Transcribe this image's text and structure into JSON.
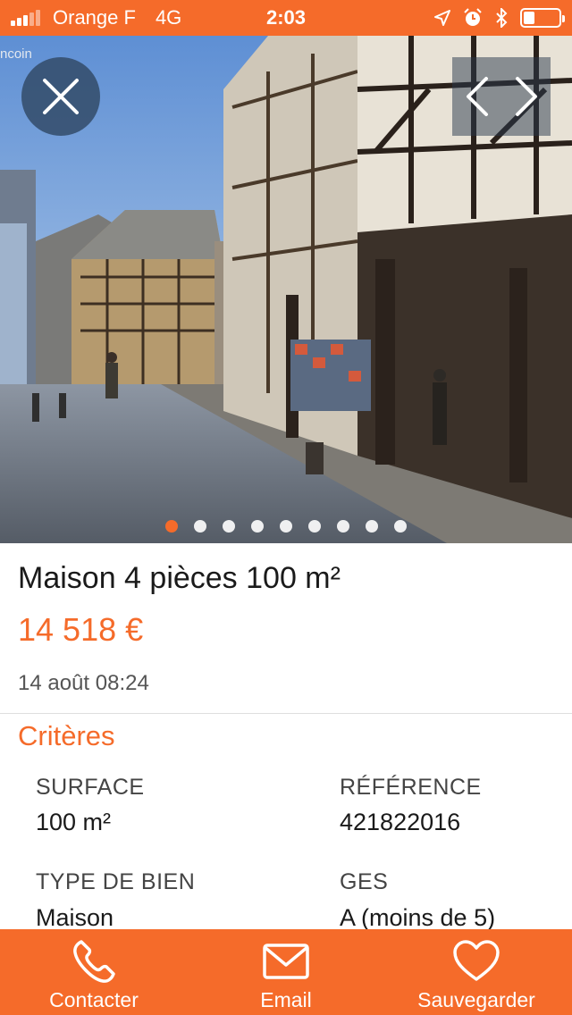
{
  "status_bar": {
    "carrier": "Orange F",
    "network": "4G",
    "time": "2:03"
  },
  "hero": {
    "watermark": "ncoin",
    "photo_count": 9,
    "active_index": 0
  },
  "listing": {
    "title": "Maison 4 pièces 100 m²",
    "price": "14 518 €",
    "date": "14 août 08:24"
  },
  "criteria": {
    "section_title": "Critères",
    "items": [
      {
        "label": "SURFACE",
        "value": "100 m²"
      },
      {
        "label": "RÉFÉRENCE",
        "value": "421822016"
      },
      {
        "label": "TYPE DE BIEN",
        "value": "Maison"
      },
      {
        "label": "GES",
        "value": "A (moins de 5)"
      }
    ]
  },
  "bottom_bar": {
    "contact_label": "Contacter",
    "email_label": "Email",
    "save_label": "Sauvegarder"
  },
  "colors": {
    "accent": "#f56b2a"
  }
}
